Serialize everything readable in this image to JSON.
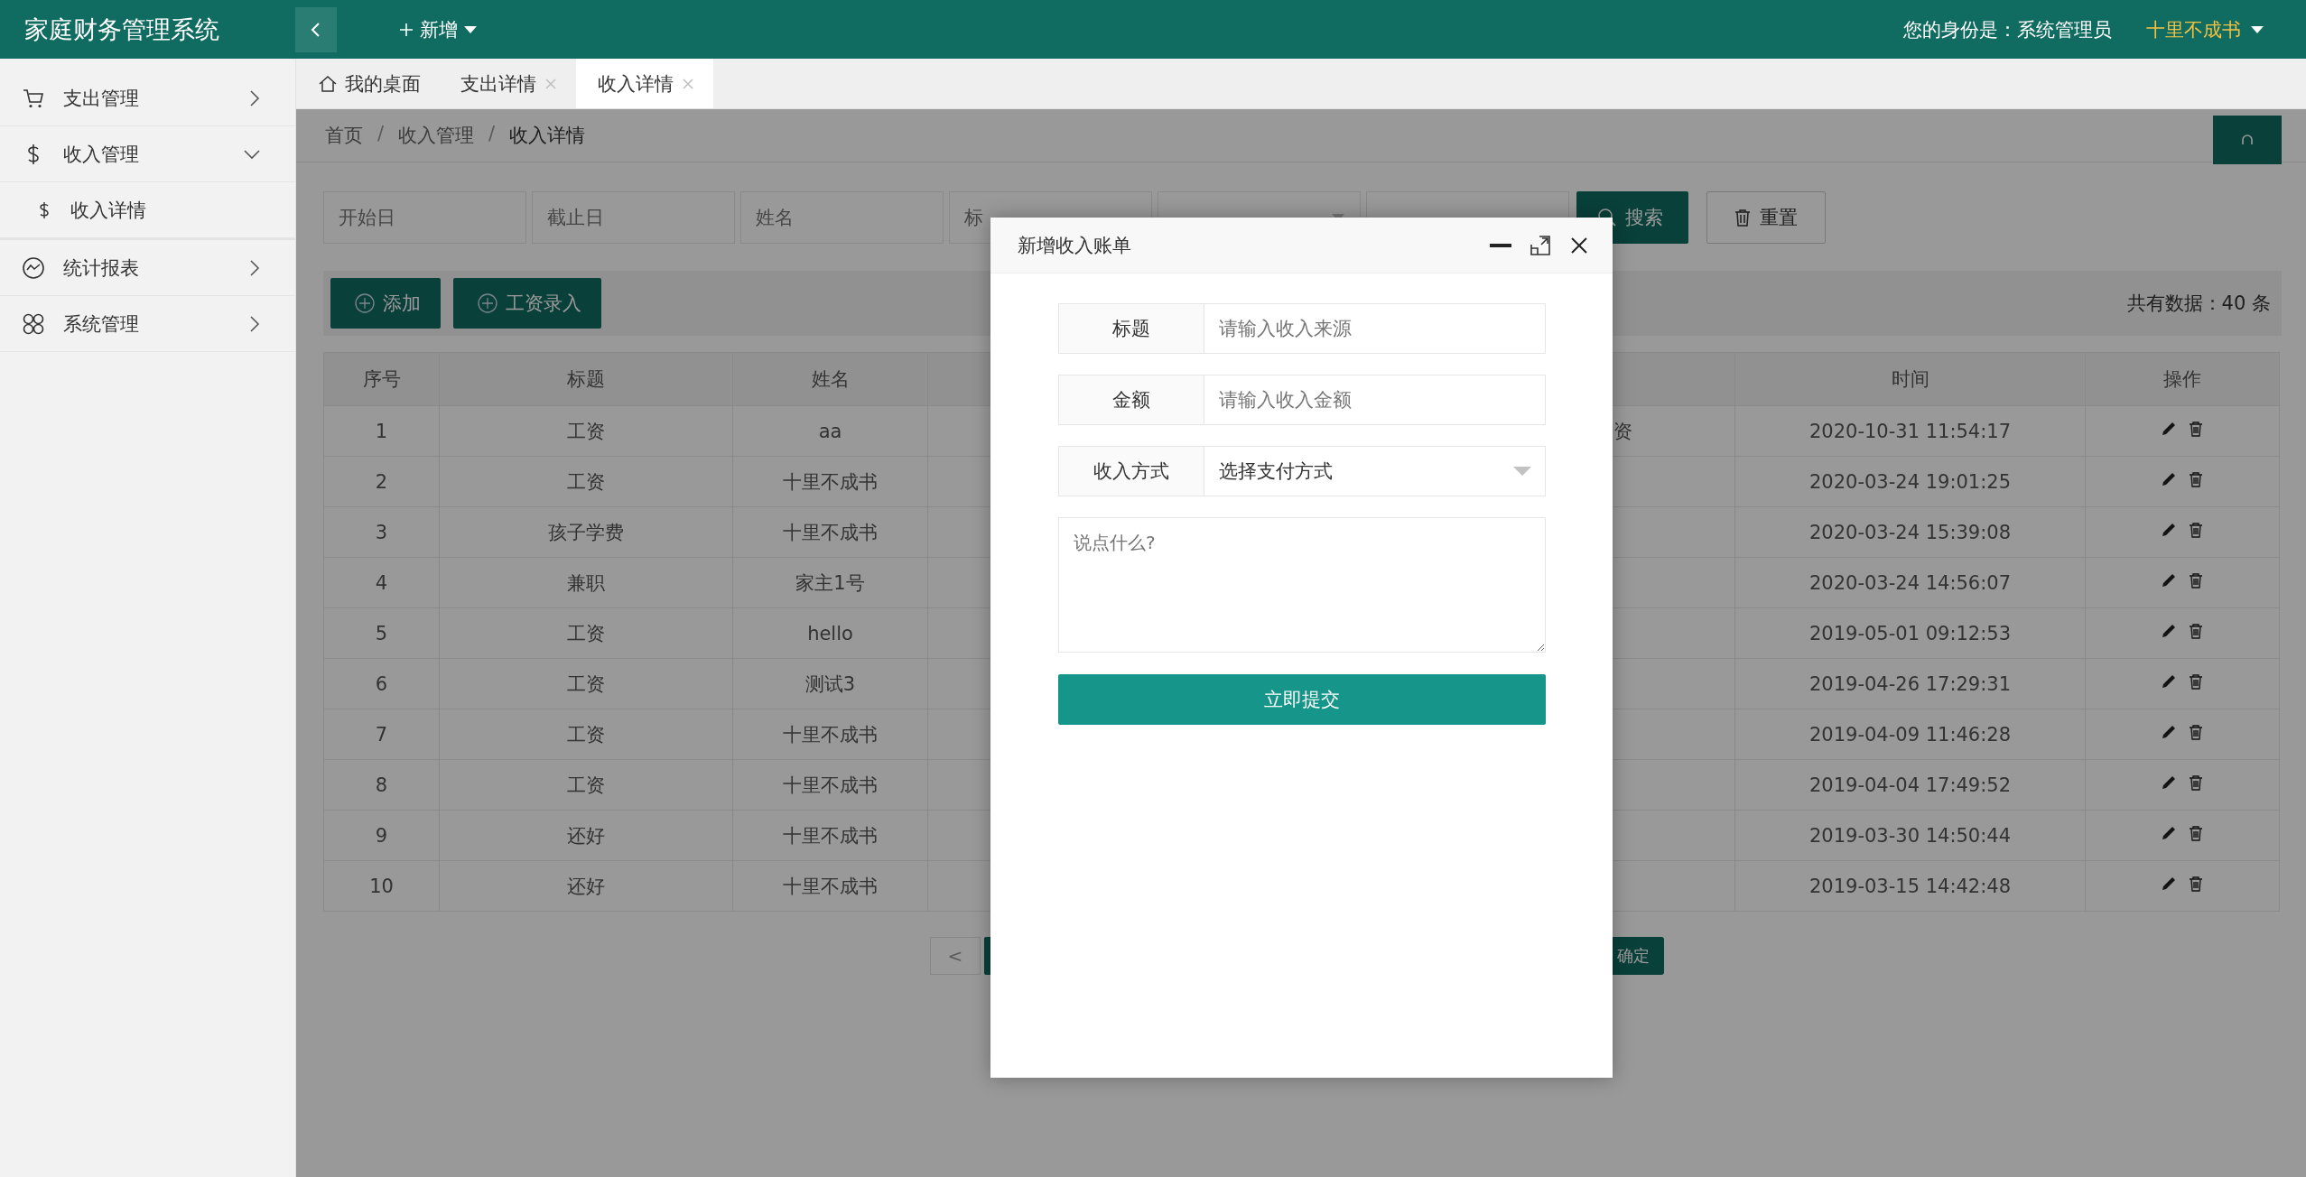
{
  "header": {
    "title": "家庭财务管理系统",
    "new_button": "新增",
    "identity": "您的身份是：系统管理员",
    "user": "十里不成书"
  },
  "sidebar": {
    "items": [
      {
        "label": "支出管理",
        "expanded": false
      },
      {
        "label": "收入管理",
        "expanded": true,
        "children": [
          {
            "label": "收入详情"
          }
        ]
      },
      {
        "label": "统计报表",
        "expanded": false
      },
      {
        "label": "系统管理",
        "expanded": false
      }
    ]
  },
  "tabs": [
    {
      "label": "我的桌面",
      "selected": false,
      "closable": false
    },
    {
      "label": "支出详情",
      "selected": false,
      "closable": true
    },
    {
      "label": "收入详情",
      "selected": true,
      "closable": true
    }
  ],
  "breadcrumb": {
    "separator": "/",
    "items": [
      "首页",
      "收入管理",
      "收入详情"
    ]
  },
  "filters": {
    "fields": [
      {
        "placeholder": "开始日"
      },
      {
        "placeholder": "截止日"
      },
      {
        "placeholder": "姓名"
      },
      {
        "placeholder": "标"
      }
    ],
    "search_button": "搜索",
    "reset_button": "重置"
  },
  "toolbar": {
    "buttons": [
      "添加",
      "工资录入"
    ],
    "total": "共有数据：40 条"
  },
  "table": {
    "columns": [
      "序号",
      "标题",
      "姓名",
      "时间",
      "操作"
    ],
    "rows": [
      {
        "seq": "1",
        "title": "工资",
        "name": "aa",
        "column_5": "资",
        "time": "2020-10-31 11:54:17"
      },
      {
        "seq": "2",
        "title": "工资",
        "name": "十里不成书",
        "time": "2020-03-24 19:01:25"
      },
      {
        "seq": "3",
        "title": "孩子学费",
        "name": "十里不成书",
        "time": "2020-03-24 15:39:08"
      },
      {
        "seq": "4",
        "title": "兼职",
        "name": "家主1号",
        "time": "2020-03-24 14:56:07"
      },
      {
        "seq": "5",
        "title": "工资",
        "name": "hello",
        "time": "2019-05-01 09:12:53"
      },
      {
        "seq": "6",
        "title": "工资",
        "name": "测试3",
        "time": "2019-04-26 17:29:31"
      },
      {
        "seq": "7",
        "title": "工资",
        "name": "十里不成书",
        "time": "2019-04-09 11:46:28"
      },
      {
        "seq": "8",
        "title": "工资",
        "name": "十里不成书",
        "time": "2019-04-04 17:49:52"
      },
      {
        "seq": "9",
        "title": "还好",
        "name": "十里不成书",
        "time": "2019-03-30 14:50:44"
      },
      {
        "seq": "10",
        "title": "还好",
        "name": "十里不成书",
        "time": "2019-03-15 14:42:48"
      }
    ]
  },
  "pagination": {
    "prev": "<",
    "confirm": "确定"
  },
  "dialog": {
    "title": "新增收入账单",
    "fields": [
      {
        "kind": "text",
        "label": "标题",
        "placeholder": "请输入收入来源"
      },
      {
        "kind": "text",
        "label": "金额",
        "placeholder": "请输入收入金额"
      },
      {
        "kind": "select",
        "label": "收入方式",
        "value": "选择支付方式"
      }
    ],
    "remark": {
      "placeholder": "说点什么?"
    },
    "submit": "立即提交"
  }
}
